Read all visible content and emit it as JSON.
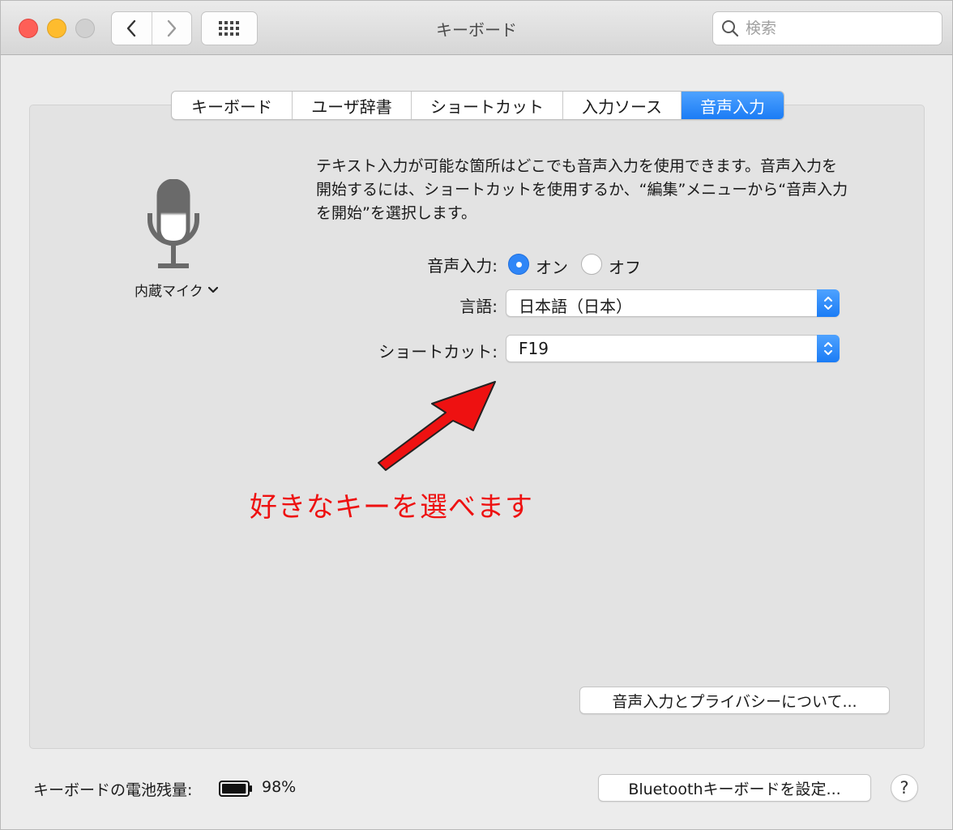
{
  "window": {
    "title": "キーボード"
  },
  "search": {
    "placeholder": "検索"
  },
  "tabs": [
    {
      "label": "キーボード"
    },
    {
      "label": "ユーザ辞書"
    },
    {
      "label": "ショートカット"
    },
    {
      "label": "入力ソース"
    },
    {
      "label": "音声入力",
      "active": true
    }
  ],
  "microphone": {
    "label": "内蔵マイク"
  },
  "description": "テキスト入力が可能な箇所はどこでも音声入力を使用できます。音声入力を開始するには、ショートカットを使用するか、“編集”メニューから“音声入力を開始”を選択します。",
  "dictation": {
    "label": "音声入力:",
    "on_label": "オン",
    "off_label": "オフ",
    "selected": "オン"
  },
  "language": {
    "label": "言語:",
    "value": "日本語（日本）"
  },
  "shortcut": {
    "label": "ショートカット:",
    "value": "F19"
  },
  "annotation": "好きなキーを選べます",
  "privacy_button": "音声入力とプライバシーについて...",
  "footer": {
    "battery_label": "キーボードの電池残量:",
    "battery_value": "98%",
    "battery_fraction": 0.98,
    "bluetooth_button": "Bluetoothキーボードを設定...",
    "help": "?"
  },
  "colors": {
    "accent": "#2f86f7",
    "annotation": "#ee1111"
  }
}
